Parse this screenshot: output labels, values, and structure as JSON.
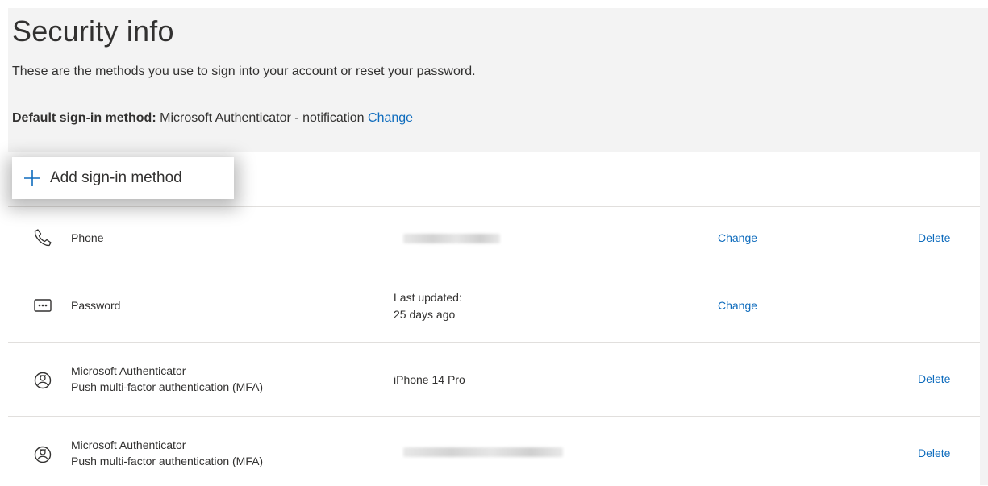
{
  "header": {
    "title": "Security info",
    "subtitle": "These are the methods you use to sign into your account or reset your password.",
    "default_label": "Default sign-in method:",
    "default_value": "Microsoft Authenticator - notification",
    "default_change": "Change"
  },
  "add_method": {
    "label": "Add sign-in method"
  },
  "methods": [
    {
      "icon": "phone-icon",
      "name": "Phone",
      "change": "Change",
      "delete": "Delete"
    },
    {
      "icon": "password-icon",
      "name": "Password",
      "detail_line1": "Last updated:",
      "detail_line2": "25 days ago",
      "change": "Change"
    },
    {
      "icon": "authenticator-icon",
      "name_line1": "Microsoft Authenticator",
      "name_line2": "Push multi-factor authentication (MFA)",
      "detail": "iPhone 14 Pro",
      "delete": "Delete"
    },
    {
      "icon": "authenticator-icon",
      "name_line1": "Microsoft Authenticator",
      "name_line2": "Push multi-factor authentication (MFA)",
      "delete": "Delete"
    }
  ],
  "colors": {
    "link": "#0f6cbd",
    "background": "#f3f3f3",
    "card": "#ffffff"
  }
}
